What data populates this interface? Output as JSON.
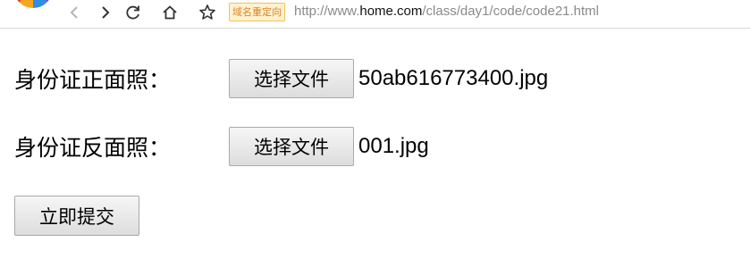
{
  "browser": {
    "logo_icon": "browser-logo-icon",
    "nav_icons": [
      "back-icon",
      "forward-icon",
      "reload-icon",
      "home-icon",
      "bookmark-star-icon"
    ],
    "redirect_badge": "域名重定向",
    "url_prefix": "http://www.",
    "url_host": "home.com",
    "url_path": "/class/day1/code/code21.html",
    "colors": {
      "badge_background": "#fff3cf",
      "badge_border": "#f0c05a",
      "badge_text": "#d9822b",
      "url_gray": "#8a8a8a"
    }
  },
  "form": {
    "front": {
      "label": "身份证正面照：",
      "button_label": "选择文件",
      "file_name": "50ab616773400.jpg"
    },
    "back": {
      "label": "身份证反面照：",
      "button_label": "选择文件",
      "file_name": "001.jpg"
    },
    "submit_label": "立即提交"
  }
}
